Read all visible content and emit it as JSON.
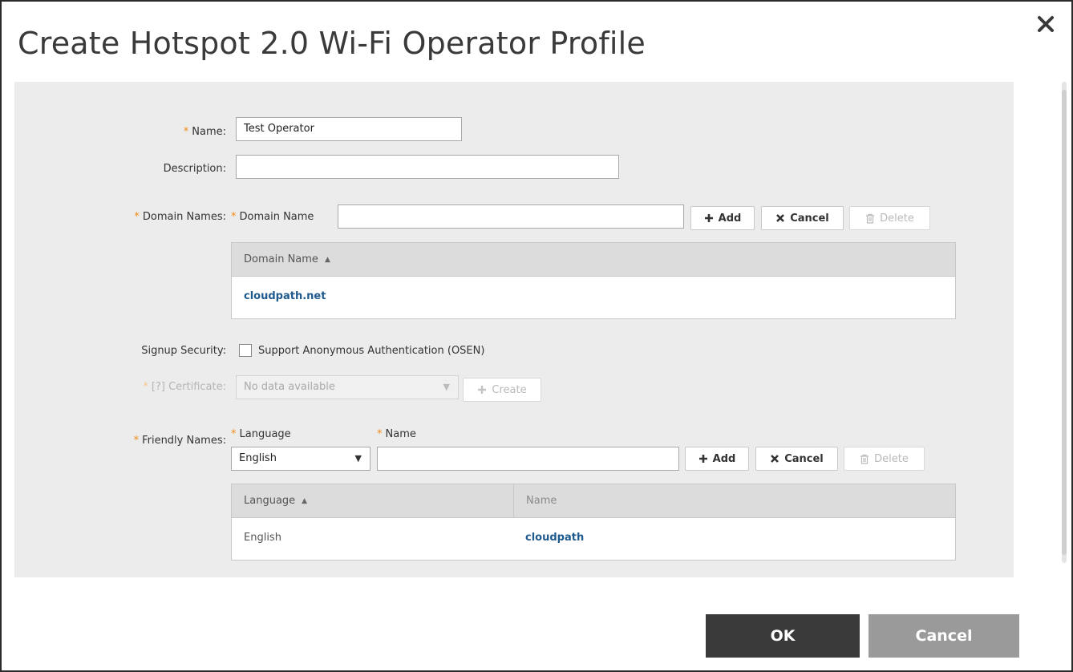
{
  "dialog": {
    "title": "Create Hotspot 2.0 Wi-Fi Operator Profile"
  },
  "form": {
    "name": {
      "required_mark": "*",
      "label": "Name:",
      "value": "Test Operator"
    },
    "description": {
      "label": "Description:",
      "value": ""
    },
    "domain_names": {
      "required_mark": "*",
      "label": "Domain Names:",
      "field_label": "Domain Name",
      "value": "",
      "add_label": "Add",
      "cancel_label": "Cancel",
      "delete_label": "Delete",
      "table": {
        "columns": [
          "Domain Name"
        ],
        "rows": [
          [
            "cloudpath.net"
          ]
        ]
      }
    },
    "signup_security": {
      "label": "Signup Security:",
      "checkbox_label": "Support Anonymous Authentication (OSEN)",
      "checked": false
    },
    "certificate": {
      "required_mark": "*",
      "label": "[?] Certificate:",
      "selected": "No data available",
      "create_label": "Create"
    },
    "friendly_names": {
      "required_mark": "*",
      "label": "Friendly Names:",
      "language_label": "Language",
      "name_label": "Name",
      "language_selected": "English",
      "name_value": "",
      "add_label": "Add",
      "cancel_label": "Cancel",
      "delete_label": "Delete",
      "table": {
        "columns": [
          "Language",
          "Name"
        ],
        "rows": [
          [
            "English",
            "cloudpath"
          ]
        ]
      }
    }
  },
  "footer": {
    "ok_label": "OK",
    "cancel_label": "Cancel"
  },
  "colors": {
    "required": "#f28c18",
    "link": "#1e5a8e",
    "ok_button": "#3a3a3a",
    "cancel_button": "#9a9a9a",
    "panel": "#ececec"
  }
}
